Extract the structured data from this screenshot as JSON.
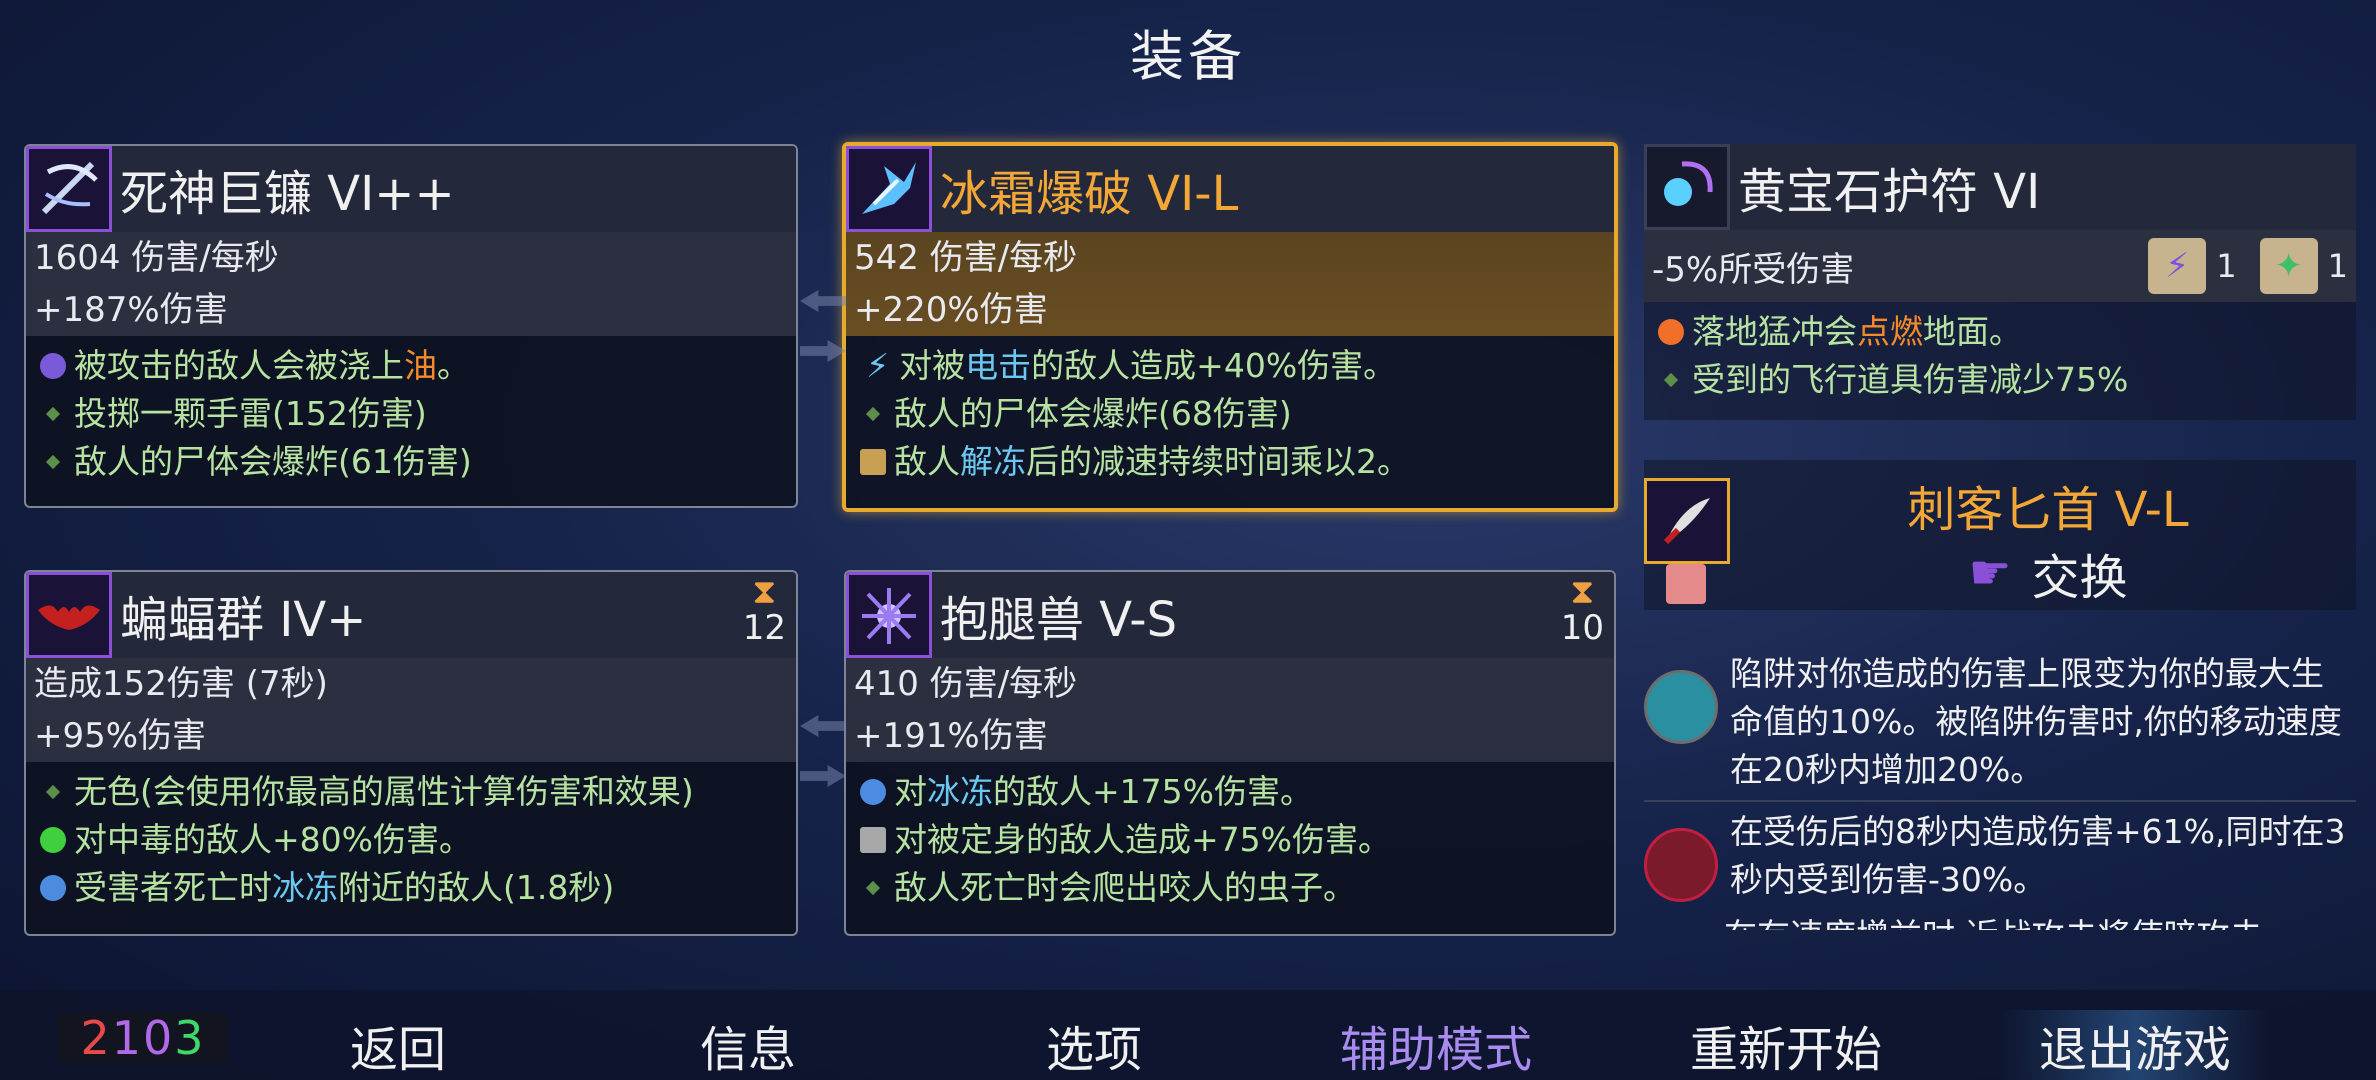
{
  "title": "装备",
  "weapons": [
    {
      "name": "死神巨镰 VI++",
      "stat1": "1604 伤害/每秒",
      "stat2": "+187%伤害",
      "effects": [
        "被攻击的敌人会被浇上",
        "油",
        "。",
        "投掷一颗手雷(152伤害)",
        "敌人的尸体会爆炸(61伤害)"
      ]
    },
    {
      "name": "冰霜爆破 VI-L",
      "stat1": "542 伤害/每秒",
      "stat2": "+220%伤害",
      "effects": [
        "对被",
        "电击",
        "的敌人造成+40%伤害。",
        "敌人的尸体会爆炸(68伤害)",
        "敌人",
        "解冻",
        "后的减速持续时间乘以2。"
      ]
    },
    {
      "name": "蝙蝠群 IV+",
      "cooldown": "12",
      "stat1": "造成152伤害 (7秒)",
      "stat2": "+95%伤害",
      "effects": [
        "无色(会使用你最高的属性计算伤害和效果)",
        "对中毒的敌人+80%伤害。",
        "受害者死亡时",
        "冰冻",
        "附近的敌人(1.8秒)"
      ]
    },
    {
      "name": "抱腿兽 V-S",
      "cooldown": "10",
      "stat1": "410 伤害/每秒",
      "stat2": "+191%伤害",
      "effects": [
        "对",
        "冰冻",
        "的敌人+175%伤害。",
        "对被定身的敌人造成+75%伤害。",
        "敌人死亡时会爬出咬人的虫子。"
      ]
    }
  ],
  "amulet": {
    "name": "黄宝石护符 VI",
    "stat": "-5%所受伤害",
    "scroll1": "1",
    "scroll2": "1",
    "effects": [
      "落地猛冲会",
      "点燃",
      "地面。",
      "受到的飞行道具伤害减少75%"
    ]
  },
  "pickup": {
    "name": "刺客匕首 V-L",
    "action": "交换"
  },
  "skills": [
    "陷阱对你造成的伤害上限变为你的最大生命值的10%。被陷阱伤害时,你的移动速度在20秒内增加20%。",
    "在受伤后的8秒内造成伤害+61%,同时在3秒内受到伤害-30%。",
    "在有速度增益时,近战攻击将使暗攻击"
  ],
  "stats_counter": {
    "red": "2",
    "purple": "10",
    "green": "3"
  },
  "nav": {
    "back": "返回",
    "info": "信息",
    "options": "选项",
    "assist": "辅助模式",
    "restart": "重新开始",
    "quit": "退出游戏"
  },
  "colors": {
    "gold": "#e6ab2e",
    "highlight_orange": "#f58a2a",
    "highlight_blue": "#6cc8f0",
    "effect_green": "#b7e3a2",
    "assist_purple": "#a98cf0"
  }
}
